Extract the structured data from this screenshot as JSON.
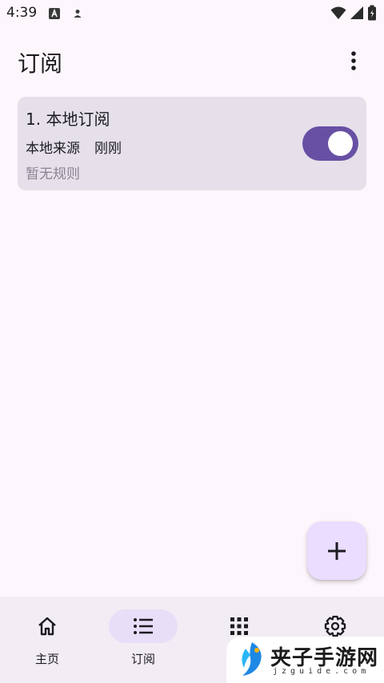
{
  "status_bar": {
    "time": "4:39",
    "icons": [
      "android-notification-icon",
      "person-notification-icon",
      "wifi-icon",
      "signal-icon",
      "battery-icon"
    ]
  },
  "app_bar": {
    "title": "订阅",
    "menu_icon": "more-vert-icon"
  },
  "subscriptions": [
    {
      "title": "1. 本地订阅",
      "source": "本地来源",
      "time": "刚刚",
      "rules": "暂无规则",
      "enabled": true
    }
  ],
  "fab": {
    "icon": "add-icon"
  },
  "bottom_nav": {
    "items": [
      {
        "label": "主页",
        "icon": "home-icon",
        "active": false
      },
      {
        "label": "订阅",
        "icon": "list-icon",
        "active": true
      },
      {
        "label": "",
        "icon": "apps-grid-icon",
        "active": false
      },
      {
        "label": "",
        "icon": "settings-gear-icon",
        "active": false
      }
    ]
  },
  "watermark": {
    "text": "夹子手游网",
    "url": "jzguide.com"
  },
  "colors": {
    "background": "#fdf7fd",
    "card": "#e6e0ea",
    "accent": "#6750a4",
    "fab": "#eaddff",
    "nav_background": "#f2ecf4",
    "nav_active_pill": "#e8def8",
    "muted_text": "#8a8392"
  }
}
